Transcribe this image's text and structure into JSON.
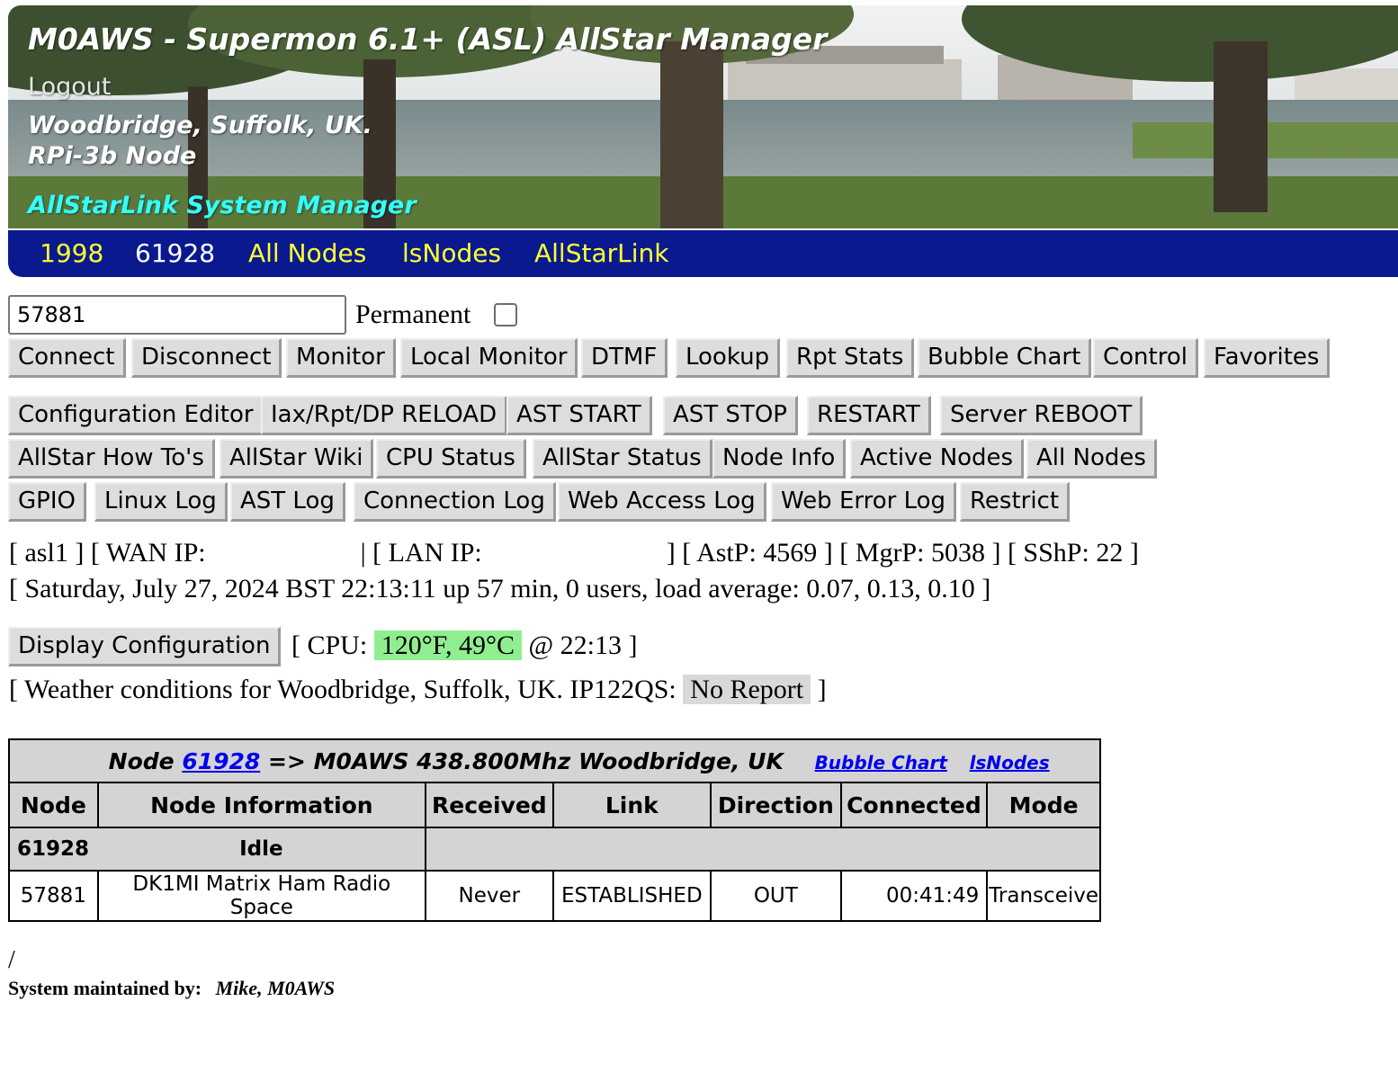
{
  "header": {
    "title": "M0AWS - Supermon 6.1+ (ASL) AllStar Manager",
    "logout": "Logout",
    "location": "Woodbridge, Suffolk, UK.",
    "node_type": "RPi-3b Node",
    "subtitle": "AllStarLink System Manager"
  },
  "nav": {
    "items": [
      {
        "label": "1998"
      },
      {
        "label": "61928"
      },
      {
        "label": "All Nodes"
      },
      {
        "label": "lsNodes"
      },
      {
        "label": "AllStarLink"
      }
    ]
  },
  "form": {
    "node_value": "57881",
    "permanent_label": "Permanent"
  },
  "buttons": {
    "connect": "Connect",
    "disconnect": "Disconnect",
    "monitor": "Monitor",
    "local_monitor": "Local Monitor",
    "dtmf": "DTMF",
    "lookup": "Lookup",
    "rpt_stats": "Rpt Stats",
    "bubble_chart": "Bubble Chart",
    "control": "Control",
    "favorites": "Favorites",
    "config_editor": "Configuration Editor",
    "reload": "Iax/Rpt/DP RELOAD",
    "ast_start": "AST START",
    "ast_stop": "AST STOP",
    "restart": "RESTART",
    "server_reboot": "Server REBOOT",
    "howtos": "AllStar How To's",
    "wiki": "AllStar Wiki",
    "cpu_status": "CPU Status",
    "allstar_status": "AllStar Status",
    "node_info": "Node Info",
    "active_nodes": "Active Nodes",
    "all_nodes": "All Nodes",
    "gpio": "GPIO",
    "linux_log": "Linux Log",
    "ast_log": "AST Log",
    "connection_log": "Connection Log",
    "web_access_log": "Web Access Log",
    "web_error_log": "Web Error Log",
    "restrict": "Restrict",
    "display_config": "Display Configuration"
  },
  "status": {
    "host": "[ asl1 ]",
    "wan_label": "[ WAN IP:",
    "lan_label": "| [ LAN IP:",
    "ports": "] [ AstP: 4569 ] [ MgrP: 5038 ] [ SShP: 22 ]",
    "uptime": "[ Saturday, July 27, 2024 BST 22:13:11 up 57 min, 0 users, load average: 0.07, 0.13, 0.10 ]",
    "cpu_prefix": "[ CPU:",
    "cpu_value": "120°F, 49°C",
    "cpu_suffix": "@ 22:13 ]",
    "weather_prefix": "[ Weather conditions for Woodbridge, Suffolk, UK. IP122QS:",
    "weather_value": "No Report",
    "weather_suffix": "]"
  },
  "table": {
    "caption_prefix": "Node",
    "caption_node": "61928",
    "caption_suffix": "=> M0AWS 438.800Mhz Woodbridge, UK",
    "caption_link_bubble": "Bubble Chart",
    "caption_link_lsnodes": "lsNodes",
    "headers": [
      "Node",
      "Node Information",
      "Received",
      "Link",
      "Direction",
      "Connected",
      "Mode"
    ],
    "idle_row": {
      "node": "61928",
      "info": "Idle"
    },
    "rows": [
      {
        "node": "57881",
        "info": "DK1MI Matrix Ham Radio Space",
        "received": "Never",
        "link": "ESTABLISHED",
        "direction": "OUT",
        "connected": "00:41:49",
        "mode": "Transceive"
      }
    ]
  },
  "footer": {
    "slash": "/",
    "maintained_label": "System maintained by:",
    "maintainer": "Mike,  M0AWS"
  }
}
